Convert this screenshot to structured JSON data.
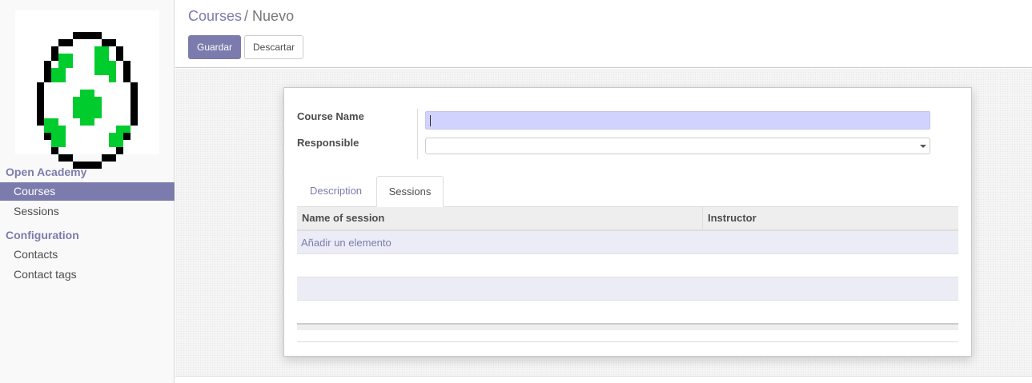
{
  "sidebar": {
    "logo_icon": "pixel-egg-logo",
    "sections": [
      {
        "label": "Open Academy"
      },
      {
        "label": "Configuration"
      }
    ],
    "items": [
      {
        "label": "Courses",
        "active": true
      },
      {
        "label": "Sessions",
        "active": false
      },
      {
        "label": "Contacts",
        "active": false
      },
      {
        "label": "Contact tags",
        "active": false
      }
    ]
  },
  "breadcrumb": {
    "parent": "Courses",
    "separator": "/",
    "current": "Nuevo"
  },
  "toolbar": {
    "save_label": "Guardar",
    "discard_label": "Descartar"
  },
  "form": {
    "course_name_label": "Course Name",
    "course_name_value": "",
    "responsible_label": "Responsible",
    "responsible_value": ""
  },
  "tabs": [
    {
      "label": "Description",
      "active": false
    },
    {
      "label": "Sessions",
      "active": true
    }
  ],
  "sessions_table": {
    "columns": [
      "Name of session",
      "Instructor"
    ],
    "add_line_label": "Añadir un elemento",
    "rows": []
  },
  "colors": {
    "accent": "#7c7bad",
    "input_highlight": "#d2d2ff",
    "egg_green": "#00cc2e"
  }
}
